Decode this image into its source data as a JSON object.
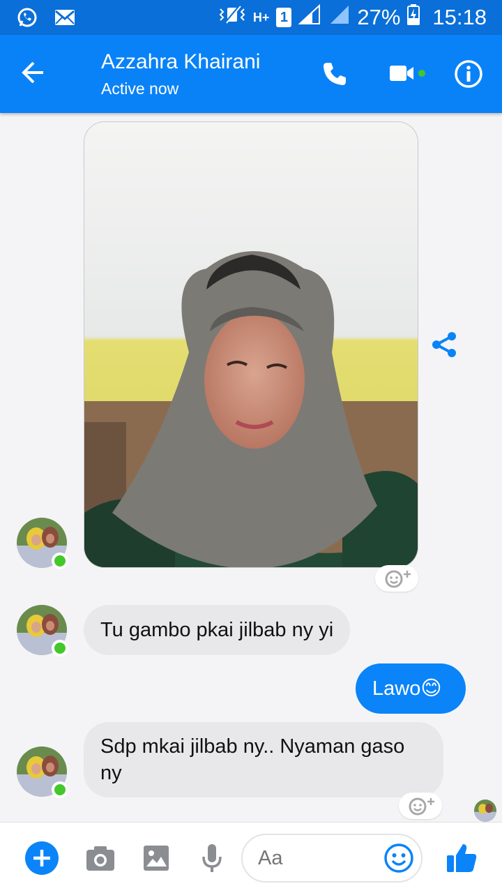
{
  "status_bar": {
    "network_h": "H+",
    "sim_slot": "1",
    "battery": "27%",
    "time": "15:18",
    "left_icons": [
      "whatsapp-icon",
      "mail-icon"
    ]
  },
  "header": {
    "name": "Azzahra Khairani",
    "status": "Active now",
    "accent": "#0a82f7",
    "online_color": "#44c72a"
  },
  "messages": [
    {
      "from": "them",
      "type": "photo",
      "alt": ""
    },
    {
      "from": "them",
      "type": "text",
      "text": "Tu gambo pkai jilbab ny yi"
    },
    {
      "from": "me",
      "type": "text",
      "text": "Lawo😊"
    },
    {
      "from": "them",
      "type": "text",
      "text": "Sdp mkai jilbab ny.. Nyaman gaso ny"
    }
  ],
  "composer": {
    "placeholder": "Aa"
  }
}
